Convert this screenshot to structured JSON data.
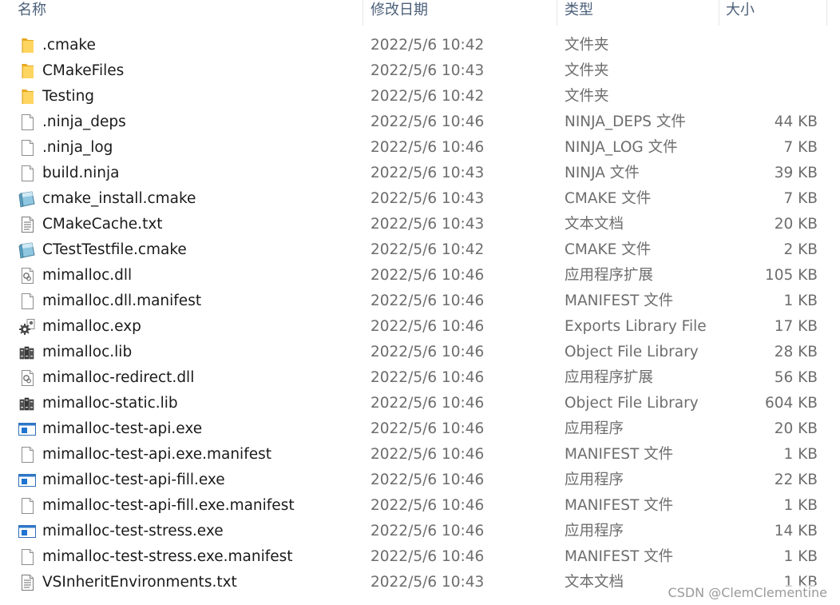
{
  "columns": {
    "name": "名称",
    "modified": "修改日期",
    "type": "类型",
    "size": "大小"
  },
  "files": [
    {
      "name": ".cmake",
      "modified": "2022/5/6 10:42",
      "type": "文件夹",
      "size": "",
      "icon": "folder-icon"
    },
    {
      "name": "CMakeFiles",
      "modified": "2022/5/6 10:43",
      "type": "文件夹",
      "size": "",
      "icon": "folder-icon"
    },
    {
      "name": "Testing",
      "modified": "2022/5/6 10:42",
      "type": "文件夹",
      "size": "",
      "icon": "folder-icon"
    },
    {
      "name": ".ninja_deps",
      "modified": "2022/5/6 10:46",
      "type": "NINJA_DEPS 文件",
      "size": "44 KB",
      "icon": "blank-file-icon"
    },
    {
      "name": ".ninja_log",
      "modified": "2022/5/6 10:46",
      "type": "NINJA_LOG 文件",
      "size": "7 KB",
      "icon": "blank-file-icon"
    },
    {
      "name": "build.ninja",
      "modified": "2022/5/6 10:43",
      "type": "NINJA 文件",
      "size": "39 KB",
      "icon": "blank-file-icon"
    },
    {
      "name": "cmake_install.cmake",
      "modified": "2022/5/6 10:43",
      "type": "CMAKE 文件",
      "size": "7 KB",
      "icon": "cmake-file-icon"
    },
    {
      "name": "CMakeCache.txt",
      "modified": "2022/5/6 10:43",
      "type": "文本文档",
      "size": "20 KB",
      "icon": "text-file-icon"
    },
    {
      "name": "CTestTestfile.cmake",
      "modified": "2022/5/6 10:42",
      "type": "CMAKE 文件",
      "size": "2 KB",
      "icon": "cmake-file-icon"
    },
    {
      "name": "mimalloc.dll",
      "modified": "2022/5/6 10:46",
      "type": "应用程序扩展",
      "size": "105 KB",
      "icon": "dll-file-icon"
    },
    {
      "name": "mimalloc.dll.manifest",
      "modified": "2022/5/6 10:46",
      "type": "MANIFEST 文件",
      "size": "1 KB",
      "icon": "blank-file-icon"
    },
    {
      "name": "mimalloc.exp",
      "modified": "2022/5/6 10:46",
      "type": "Exports Library File",
      "size": "17 KB",
      "icon": "gear-file-icon"
    },
    {
      "name": "mimalloc.lib",
      "modified": "2022/5/6 10:46",
      "type": "Object File Library",
      "size": "28 KB",
      "icon": "library-file-icon"
    },
    {
      "name": "mimalloc-redirect.dll",
      "modified": "2022/5/6 10:46",
      "type": "应用程序扩展",
      "size": "56 KB",
      "icon": "dll-file-icon"
    },
    {
      "name": "mimalloc-static.lib",
      "modified": "2022/5/6 10:46",
      "type": "Object File Library",
      "size": "604 KB",
      "icon": "library-file-icon"
    },
    {
      "name": "mimalloc-test-api.exe",
      "modified": "2022/5/6 10:46",
      "type": "应用程序",
      "size": "20 KB",
      "icon": "exe-file-icon"
    },
    {
      "name": "mimalloc-test-api.exe.manifest",
      "modified": "2022/5/6 10:46",
      "type": "MANIFEST 文件",
      "size": "1 KB",
      "icon": "blank-file-icon"
    },
    {
      "name": "mimalloc-test-api-fill.exe",
      "modified": "2022/5/6 10:46",
      "type": "应用程序",
      "size": "22 KB",
      "icon": "exe-file-icon"
    },
    {
      "name": "mimalloc-test-api-fill.exe.manifest",
      "modified": "2022/5/6 10:46",
      "type": "MANIFEST 文件",
      "size": "1 KB",
      "icon": "blank-file-icon"
    },
    {
      "name": "mimalloc-test-stress.exe",
      "modified": "2022/5/6 10:46",
      "type": "应用程序",
      "size": "14 KB",
      "icon": "exe-file-icon"
    },
    {
      "name": "mimalloc-test-stress.exe.manifest",
      "modified": "2022/5/6 10:46",
      "type": "MANIFEST 文件",
      "size": "1 KB",
      "icon": "blank-file-icon"
    },
    {
      "name": "VSInheritEnvironments.txt",
      "modified": "2022/5/6 10:43",
      "type": "文本文档",
      "size": "1 KB",
      "icon": "text-file-icon"
    }
  ],
  "watermark": "CSDN @ClemClementine",
  "colors": {
    "header_text": "#4c607a",
    "name_text": "#1a1a1a",
    "meta_text": "#6d6d6d",
    "folder": "#f5c242",
    "exe_blue": "#1e74d0"
  }
}
